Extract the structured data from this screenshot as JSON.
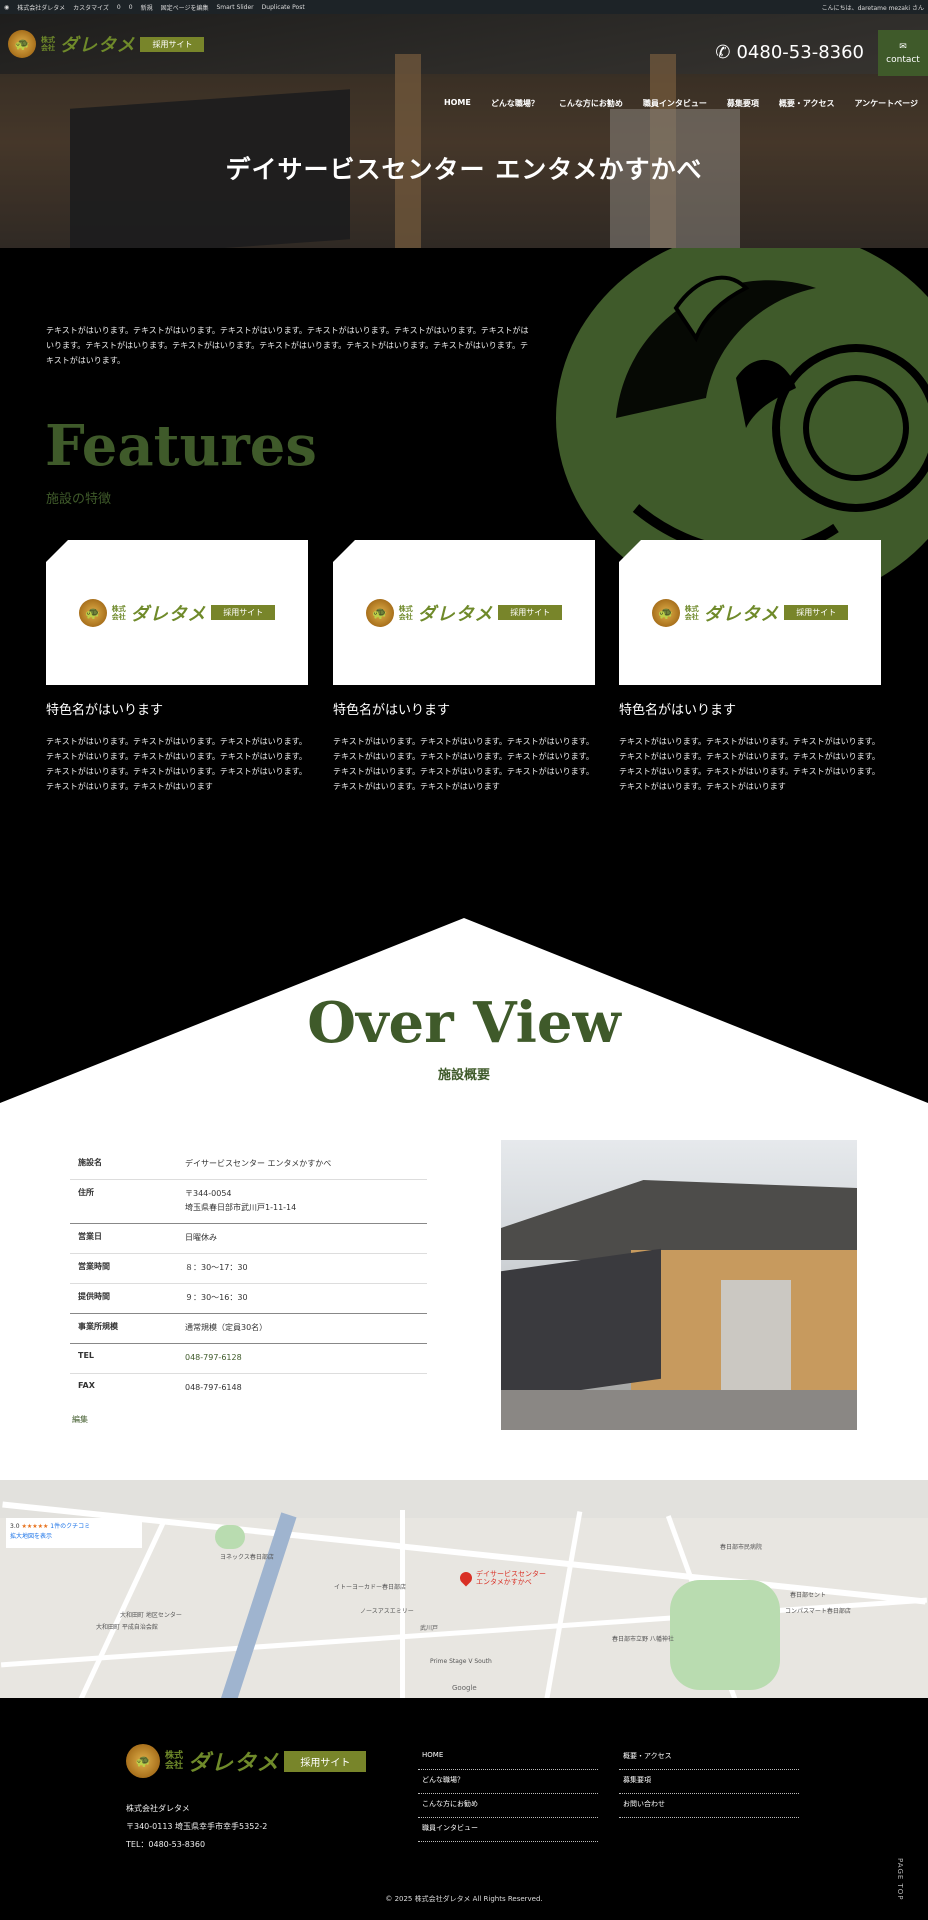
{
  "admin_bar": {
    "items": [
      "株式会社ダレタメ",
      "カスタマイズ",
      "0",
      "0",
      "新規",
      "固定ページを編集",
      "Smart Slider",
      "Duplicate Post"
    ],
    "greeting": "こんにちは、daretame mezaki さん"
  },
  "header": {
    "logo_corp_line1": "株式",
    "logo_corp_line2": "会社",
    "logo_name": "ダレタメ",
    "logo_tag": "採用サイト",
    "phone": "0480-53-8360",
    "contact_label": "contact",
    "nav": [
      "HOME",
      "どんな職場？",
      "こんな方にお勧め",
      "職員インタビュー",
      "募集要項",
      "概要・アクセス",
      "アンケートページ"
    ]
  },
  "hero": {
    "title": "デイサービスセンター エンタメかすかべ"
  },
  "features": {
    "intro": "テキストがはいります。テキストがはいります。テキストがはいります。テキストがはいります。テキストがはいります。テキストがはいります。テキストがはいります。テキストがはいります。テキストがはいります。テキストがはいります。テキストがはいります。テキストがはいります。",
    "heading": "Features",
    "subheading": "施設の特徴",
    "cards": [
      {
        "logo_corp_line1": "株式",
        "logo_corp_line2": "会社",
        "logo_name": "ダレタメ",
        "logo_tag": "採用サイト",
        "title": "特色名がはいります",
        "text": "テキストがはいります。テキストがはいります。テキストがはいります。テキストがはいります。テキストがはいります。テキストがはいります。テキストがはいります。テキストがはいります。テキストがはいります。テキストがはいります。テキストがはいります"
      },
      {
        "logo_corp_line1": "株式",
        "logo_corp_line2": "会社",
        "logo_name": "ダレタメ",
        "logo_tag": "採用サイト",
        "title": "特色名がはいります",
        "text": "テキストがはいります。テキストがはいります。テキストがはいります。テキストがはいります。テキストがはいります。テキストがはいります。テキストがはいります。テキストがはいります。テキストがはいります。テキストがはいります。テキストがはいります"
      },
      {
        "logo_corp_line1": "株式",
        "logo_corp_line2": "会社",
        "logo_name": "ダレタメ",
        "logo_tag": "採用サイト",
        "title": "特色名がはいります",
        "text": "テキストがはいります。テキストがはいります。テキストがはいります。テキストがはいります。テキストがはいります。テキストがはいります。テキストがはいります。テキストがはいります。テキストがはいります。テキストがはいります。テキストがはいります"
      }
    ]
  },
  "overview": {
    "heading": "Over View",
    "subheading": "施設概要",
    "rows": [
      {
        "key": "施設名",
        "value": "デイサービスセンター エンタメかすかべ"
      },
      {
        "key": "住所",
        "value": "〒344-0054\n埼玉県春日部市武川戸1-11-14"
      },
      {
        "key": "営業日",
        "value": "日曜休み"
      },
      {
        "key": "営業時間",
        "value": "８：30〜17：30"
      },
      {
        "key": "提供時間",
        "value": "９：30〜16：30"
      },
      {
        "key": "事業所規模",
        "value": "通常規模（定員30名）"
      },
      {
        "key": "TEL",
        "value": "048-797-6128"
      },
      {
        "key": "FAX",
        "value": "048-797-6148"
      }
    ],
    "edit_link": "編集"
  },
  "map": {
    "rating": "3.0",
    "stars": "★★★★★",
    "reviews": "1件のクチコミ",
    "enlarge": "拡大地図を表示",
    "pin_label": "デイサービスセンター エンタメかすかべ",
    "labels": [
      "ヨネックス春日部店",
      "大和田町 地区センター",
      "大和田町 平成自治会館",
      "イトーヨーカドー春日部店",
      "ノースアスエミリー",
      "武川戸",
      "Prime Stage V South",
      "春日部市立野 八幡神社",
      "コンパスマート春日部店",
      "春日部セント",
      "春日部市民病院"
    ],
    "attribution": "Google"
  },
  "footer": {
    "logo_corp_line1": "株式",
    "logo_corp_line2": "会社",
    "logo_name": "ダレタメ",
    "logo_tag": "採用サイト",
    "company": "株式会社ダレタメ",
    "address": "〒340-0113 埼玉県幸手市幸手5352-2",
    "tel": "TEL：0480-53-8360",
    "links_col1": [
      "HOME",
      "どんな職場？",
      "こんな方にお勧め",
      "職員インタビュー"
    ],
    "links_col2": [
      "概要・アクセス",
      "募集要項",
      "お問い合わせ"
    ],
    "copyright": "© 2025 株式会社ダレタメ All Rights Reserved.",
    "page_top": "PAGE TOP"
  },
  "colors": {
    "accent": "#3f5a2a",
    "tag": "#78852a",
    "bg": "#000000"
  }
}
